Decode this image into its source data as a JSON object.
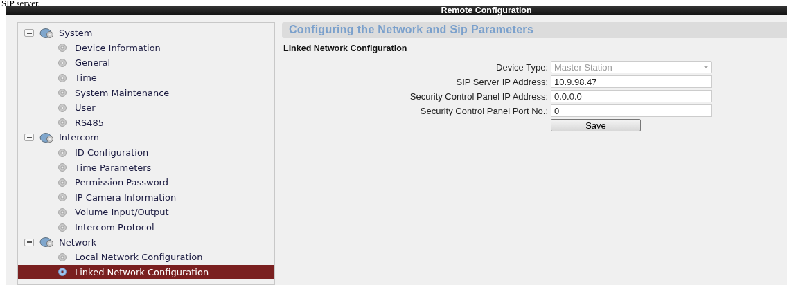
{
  "caption": "SIP server.",
  "window": {
    "title": "Remote Configuration"
  },
  "sidebar": {
    "groups": [
      {
        "label": "System",
        "expanded": true,
        "children": [
          {
            "label": "Device Information",
            "selected": false
          },
          {
            "label": "General",
            "selected": false
          },
          {
            "label": "Time",
            "selected": false
          },
          {
            "label": "System Maintenance",
            "selected": false
          },
          {
            "label": "User",
            "selected": false
          },
          {
            "label": "RS485",
            "selected": false
          }
        ]
      },
      {
        "label": "Intercom",
        "expanded": true,
        "children": [
          {
            "label": "ID Configuration",
            "selected": false
          },
          {
            "label": "Time Parameters",
            "selected": false
          },
          {
            "label": "Permission Password",
            "selected": false
          },
          {
            "label": "IP Camera Information",
            "selected": false
          },
          {
            "label": "Volume Input/Output",
            "selected": false
          },
          {
            "label": "Intercom Protocol",
            "selected": false
          }
        ]
      },
      {
        "label": "Network",
        "expanded": true,
        "children": [
          {
            "label": "Local Network Configuration",
            "selected": false
          },
          {
            "label": "Linked Network Configuration",
            "selected": true
          }
        ]
      }
    ]
  },
  "panel": {
    "heading": "Configuring the Network and Sip Parameters",
    "section": "Linked Network Configuration",
    "fields": [
      {
        "kind": "select",
        "label": "Device Type:",
        "value": "Master Station",
        "disabled": true
      },
      {
        "kind": "text",
        "label": "SIP Server IP Address:",
        "value": "10.9.98.47",
        "disabled": false
      },
      {
        "kind": "text",
        "label": "Security Control Panel IP Address:",
        "value": "0.0.0.0",
        "disabled": false
      },
      {
        "kind": "text",
        "label": "Security Control Panel Port No.:",
        "value": "0",
        "disabled": false
      }
    ],
    "save_button": "Save"
  }
}
